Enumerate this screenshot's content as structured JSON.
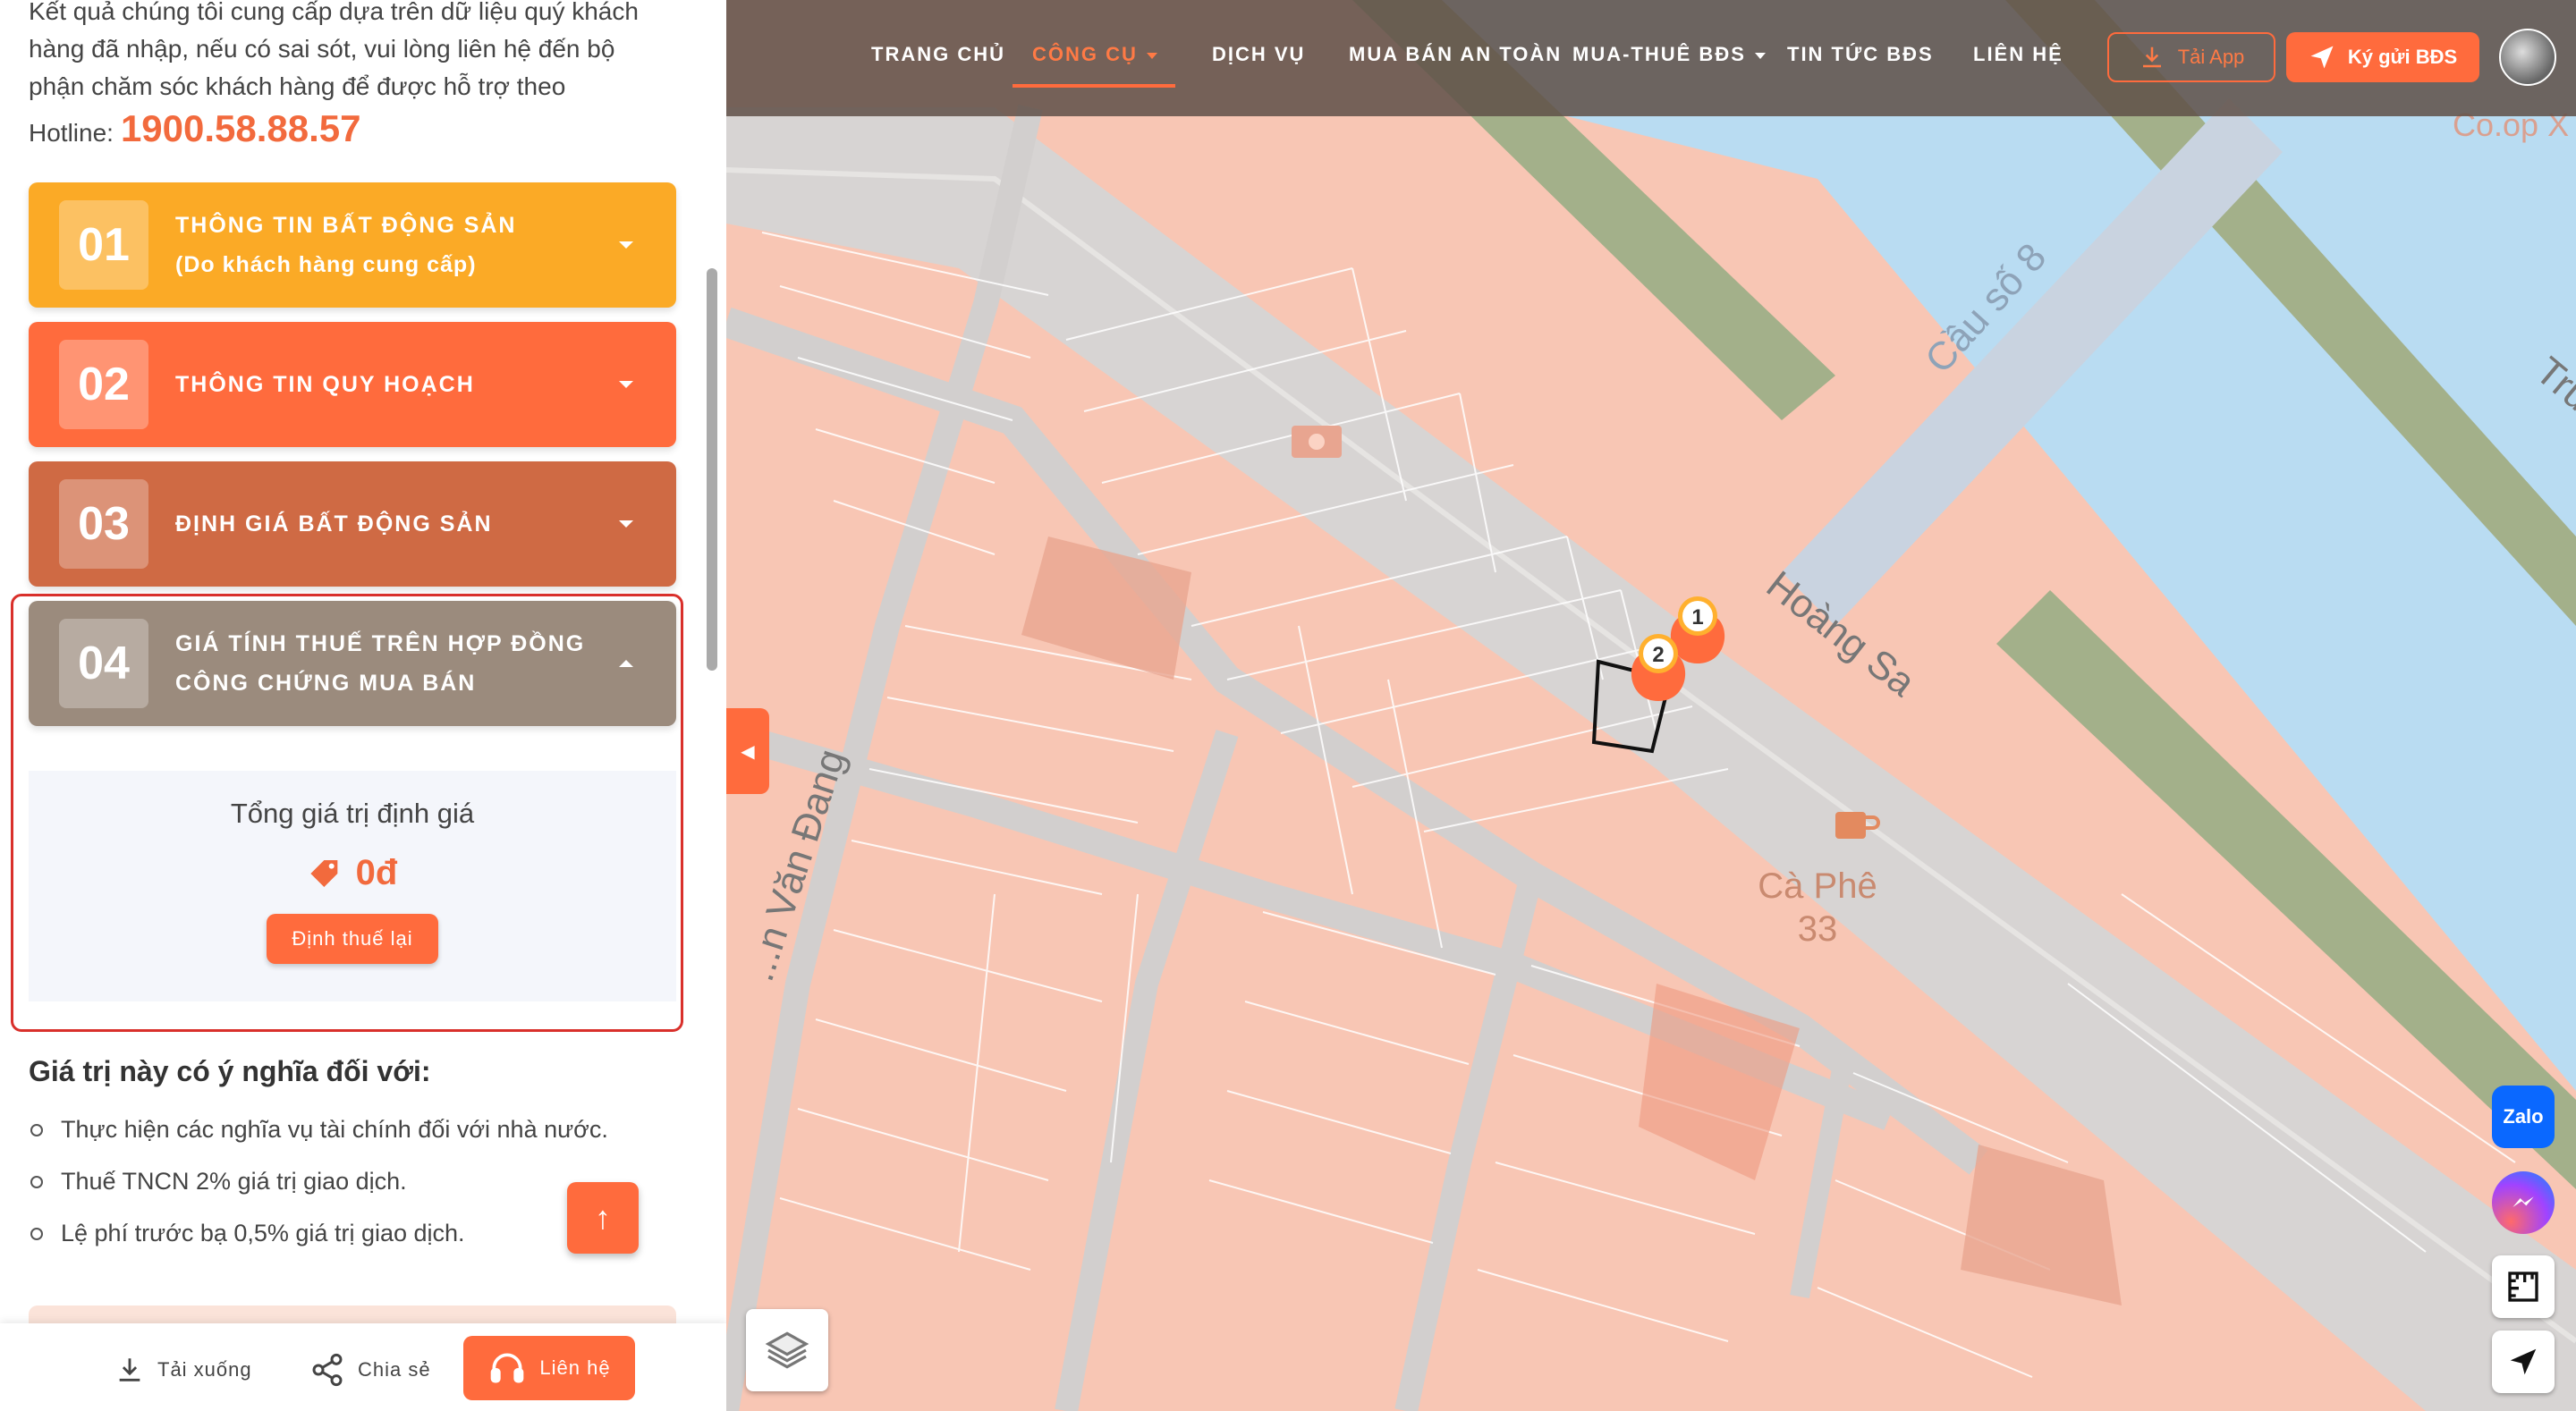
{
  "intro": {
    "text": "Kết quả chúng tôi cung cấp dựa trên dữ liệu quý khách hàng đã nhập, nếu có sai sót, vui lòng liên hệ đến bộ phận chăm sóc khách hàng để được hỗ trợ theo",
    "hotline_label": "Hotline:",
    "hotline_number": "1900.58.88.57"
  },
  "sections": [
    {
      "num": "01",
      "title_line1": "THÔNG TIN BẤT ĐỘNG SẢN",
      "title_line2": "(Do khách hàng cung cấp)",
      "color": "#fbaa26"
    },
    {
      "num": "02",
      "title_line1": "THÔNG TIN QUY HOẠCH",
      "title_line2": "",
      "color": "#ff6b3d"
    },
    {
      "num": "03",
      "title_line1": "ĐỊNH GIÁ BẤT ĐỘNG SẢN",
      "title_line2": "",
      "color": "#cf6a44"
    },
    {
      "num": "04",
      "title_line1": "GIÁ TÍNH THUẾ TRÊN HỢP ĐỒNG",
      "title_line2": "CÔNG CHỨNG MUA BÁN",
      "color": "#9b8b7d"
    }
  ],
  "result": {
    "label": "Tổng giá trị định giá",
    "value": "0đ",
    "recalc_button": "Định thuế lại"
  },
  "meaning": {
    "title": "Giá trị này có ý nghĩa đối với:",
    "items": [
      "Thực hiện các nghĩa vụ tài chính đối với nhà nước.",
      "Thuế TNCN 2% giá trị giao dịch.",
      "Lệ phí trước bạ 0,5% giá trị giao dịch."
    ]
  },
  "bottom_bar": {
    "download": "Tải xuống",
    "share": "Chia sẻ",
    "contact": "Liên hệ"
  },
  "nav": {
    "home": "TRANG CHỦ",
    "tools": "CÔNG CỤ",
    "services": "DỊCH VỤ",
    "safe_trade": "MUA BÁN AN TOÀN",
    "buy_rent": "MUA-THUÊ BĐS",
    "news": "TIN TỨC BĐS",
    "contact": "LIÊN HỆ",
    "app_button": "Tải App",
    "consign_button": "Ký gửi BĐS"
  },
  "map": {
    "labels": {
      "bridge": "Cầu số 8",
      "street_hoang_sa": "Hoàng Sa",
      "street_left": "...n Văn Đang",
      "cafe_name": "Cà Phê",
      "cafe_number": "33",
      "corner_text": "Co.op X",
      "edge_text": "Tru"
    },
    "markers": [
      "1",
      "2"
    ],
    "zalo_label": "Zalo"
  },
  "colors": {
    "accent": "#ff6b3d",
    "highlight_border": "#d9302b",
    "map_parcel": "#f8c6b4",
    "river": "#b9dcf2",
    "riverbank": "#a3b08a"
  }
}
